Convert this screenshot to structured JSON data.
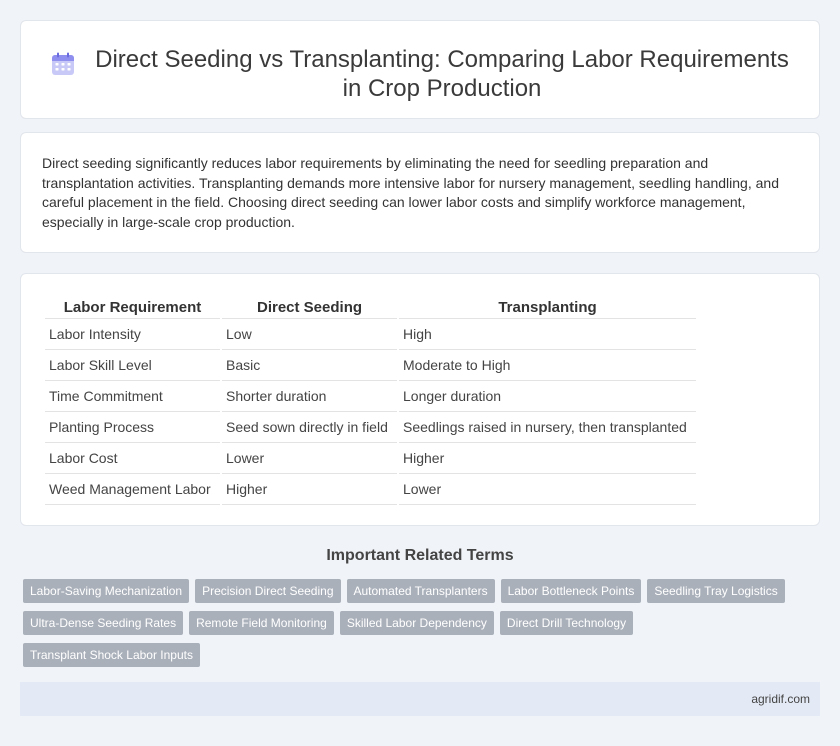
{
  "header": {
    "title": "Direct Seeding vs Transplanting: Comparing Labor Requirements in Crop Production",
    "icon": "calendar-icon"
  },
  "description": "Direct seeding significantly reduces labor requirements by eliminating the need for seedling preparation and transplantation activities. Transplanting demands more intensive labor for nursery management, seedling handling, and careful placement in the field. Choosing direct seeding can lower labor costs and simplify workforce management, especially in large-scale crop production.",
  "table": {
    "headers": [
      "Labor Requirement",
      "Direct Seeding",
      "Transplanting"
    ],
    "rows": [
      [
        "Labor Intensity",
        "Low",
        "High"
      ],
      [
        "Labor Skill Level",
        "Basic",
        "Moderate to High"
      ],
      [
        "Time Commitment",
        "Shorter duration",
        "Longer duration"
      ],
      [
        "Planting Process",
        "Seed sown directly in field",
        "Seedlings raised in nursery, then transplanted"
      ],
      [
        "Labor Cost",
        "Lower",
        "Higher"
      ],
      [
        "Weed Management Labor",
        "Higher",
        "Lower"
      ]
    ]
  },
  "related": {
    "heading": "Important Related Terms",
    "terms": [
      "Labor-Saving Mechanization",
      "Precision Direct Seeding",
      "Automated Transplanters",
      "Labor Bottleneck Points",
      "Seedling Tray Logistics",
      "Ultra-Dense Seeding Rates",
      "Remote Field Monitoring",
      "Skilled Labor Dependency",
      "Direct Drill Technology",
      "Transplant Shock Labor Inputs"
    ]
  },
  "footer": {
    "site": "agridif.com"
  },
  "colors": {
    "background": "#f0f3f8",
    "term_chip": "#aab0ba",
    "footer_bar": "#e4eaf5",
    "icon_accent": "#8f8ff0"
  }
}
